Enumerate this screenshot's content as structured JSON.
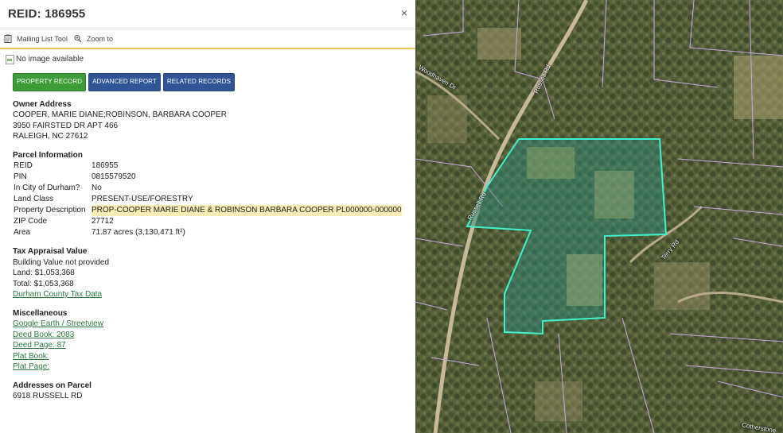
{
  "panel": {
    "title": "REID: 186955",
    "close_label": "×",
    "tools": [
      {
        "label": "Mailing List Tool",
        "icon": "clipboard-icon"
      },
      {
        "label": "Zoom to",
        "icon": "zoom-icon"
      }
    ],
    "no_image": "No image available",
    "buttons": [
      {
        "label": "PROPERTY RECORD",
        "color": "#3c9c36"
      },
      {
        "label": "ADVANCED REPORT",
        "color": "#2f5597"
      },
      {
        "label": "RELATED RECORDS",
        "color": "#2f5597"
      }
    ],
    "owner": {
      "heading": "Owner Address",
      "lines": [
        "COOPER, MARIE DIANE;ROBINSON, BARBARA COOPER",
        "3950 FAIRSTED DR APT 466",
        "RALEIGH, NC 27612"
      ]
    },
    "parcel": {
      "heading": "Parcel Information",
      "rows": [
        {
          "key": "REID",
          "value": "186955"
        },
        {
          "key": "PIN",
          "value": "0815579520"
        },
        {
          "key": "In City of Durham?",
          "value": "No"
        },
        {
          "key": "Land Class",
          "value": "PRESENT-USE/FORESTRY"
        },
        {
          "key": "Property Description",
          "value": "PROP-COOPER MARIE DIANE & ROBINSON BARBARA COOPER PL000000-000000"
        },
        {
          "key": "ZIP Code",
          "value": "27712"
        },
        {
          "key": "Area",
          "value": "71.87 acres (3,130,471 ft²)"
        }
      ]
    },
    "tax": {
      "heading": "Tax Appraisal Value",
      "lines": [
        "Building Value not provided",
        "Land: $1,053,368",
        "Total: $1,053,368"
      ],
      "link": "Durham County Tax Data"
    },
    "misc": {
      "heading": "Miscellaneous",
      "links": [
        "Google Earth / Streetview",
        "Deed Book: 2083",
        "Deed Page: 87",
        "Plat Book:",
        "Plat Page:"
      ]
    },
    "addresses": {
      "heading": "Addresses on Parcel",
      "lines": [
        "6918 RUSSELL RD"
      ]
    }
  },
  "map": {
    "road_labels": [
      "Woodhaven Dr",
      "Russell Rd",
      "Russell Rd",
      "Terry Rd",
      "Cotherstone"
    ],
    "parcel_outline_color": "#3ff2cf",
    "parcel_line_color": "#c9a7e8"
  }
}
